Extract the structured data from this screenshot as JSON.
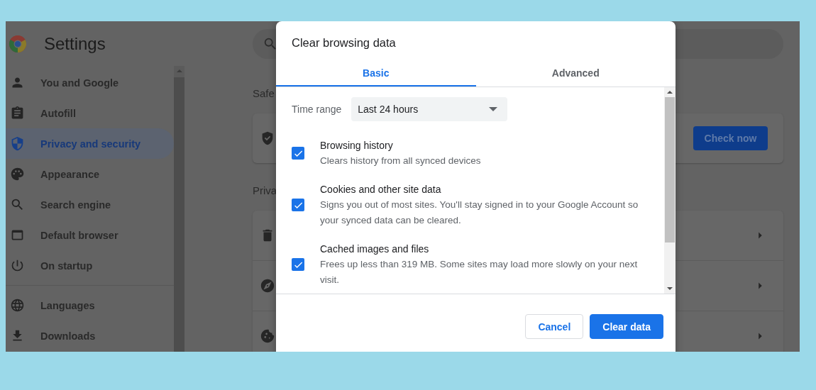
{
  "settings": {
    "title": "Settings",
    "sidebar": {
      "sections": [
        {
          "items": [
            {
              "label": "You and Google",
              "selected": false
            },
            {
              "label": "Autofill",
              "selected": false
            },
            {
              "label": "Privacy and security",
              "selected": true
            },
            {
              "label": "Appearance",
              "selected": false
            },
            {
              "label": "Search engine",
              "selected": false
            },
            {
              "label": "Default browser",
              "selected": false
            },
            {
              "label": "On startup",
              "selected": false
            }
          ]
        },
        {
          "items": [
            {
              "label": "Languages",
              "selected": false
            },
            {
              "label": "Downloads",
              "selected": false
            }
          ]
        }
      ]
    },
    "main": {
      "safety_heading": "Safe",
      "check_button": "Check now",
      "privacy_heading": "Priva"
    }
  },
  "dialog": {
    "title": "Clear browsing data",
    "tabs": [
      {
        "label": "Basic",
        "selected": true
      },
      {
        "label": "Advanced",
        "selected": false
      }
    ],
    "time_range": {
      "label": "Time range",
      "value": "Last 24 hours"
    },
    "options": [
      {
        "title": "Browsing history",
        "description": "Clears history from all synced devices",
        "checked": true
      },
      {
        "title": "Cookies and other site data",
        "description": "Signs you out of most sites. You'll stay signed in to your Google Account so your synced data can be cleared.",
        "checked": true
      },
      {
        "title": "Cached images and files",
        "description": "Frees up less than 319 MB. Some sites may load more slowly on your next visit.",
        "checked": true
      }
    ],
    "buttons": [
      {
        "label": "Cancel",
        "kind": "secondary"
      },
      {
        "label": "Clear data",
        "kind": "primary"
      }
    ]
  }
}
